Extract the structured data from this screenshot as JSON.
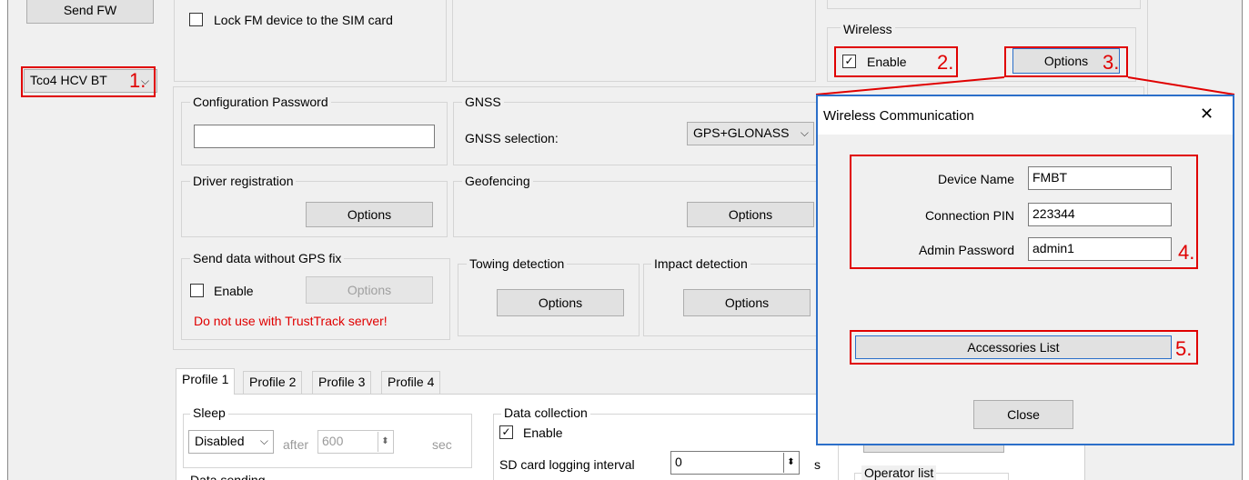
{
  "left": {
    "send_fw": "Send FW",
    "device_combo": "Tco4 HCV BT"
  },
  "top": {
    "lock_label": "Lock FM device to the SIM card"
  },
  "config_password": {
    "title": "Configuration Password",
    "value": ""
  },
  "gnss": {
    "title": "GNSS",
    "selection_label": "GNSS selection:",
    "selection_value": "GPS+GLONASS"
  },
  "driver_registration": {
    "title": "Driver registration",
    "options": "Options"
  },
  "geofencing": {
    "title": "Geofencing",
    "options": "Options"
  },
  "send_without_gps": {
    "title": "Send data without GPS fix",
    "enable": "Enable",
    "options": "Options",
    "warning": "Do not use with TrustTrack server!"
  },
  "towing": {
    "title": "Towing detection",
    "options": "Options"
  },
  "impact": {
    "title": "Impact detection",
    "options": "Options"
  },
  "wireless": {
    "title": "Wireless",
    "enable": "Enable",
    "options": "Options",
    "enable_checked": true
  },
  "tabs": [
    {
      "label": "Profile 1"
    },
    {
      "label": "Profile 2"
    },
    {
      "label": "Profile 3"
    },
    {
      "label": "Profile 4"
    }
  ],
  "sleep": {
    "title": "Sleep",
    "mode": "Disabled",
    "after": "after",
    "value": "600",
    "unit": "sec"
  },
  "data_sending": {
    "title": "Data sending"
  },
  "data_collection": {
    "title": "Data collection",
    "enable": "Enable",
    "sd_label": "SD card logging interval",
    "sd_value": "0",
    "sd_unit": "s"
  },
  "operator_list": {
    "title": "Operator list"
  },
  "dialog": {
    "title": "Wireless Communication",
    "close_glyph": "✕",
    "device_name_label": "Device Name",
    "device_name_value": "FMBT",
    "connection_pin_label": "Connection PIN",
    "connection_pin_value": "223344",
    "admin_password_label": "Admin Password",
    "admin_password_value": "admin1",
    "accessories_button": "Accessories List",
    "close_button": "Close"
  },
  "annotations": {
    "n1": "1.",
    "n2": "2.",
    "n3": "3.",
    "n4": "4.",
    "n5": "5."
  },
  "colors": {
    "highlight": "#e00000",
    "dialog_border": "#2c6fc9",
    "window_bg": "#f0f0f0"
  },
  "icons": {
    "check": "☑",
    "chevron": "⌵",
    "spin": "⬍"
  }
}
